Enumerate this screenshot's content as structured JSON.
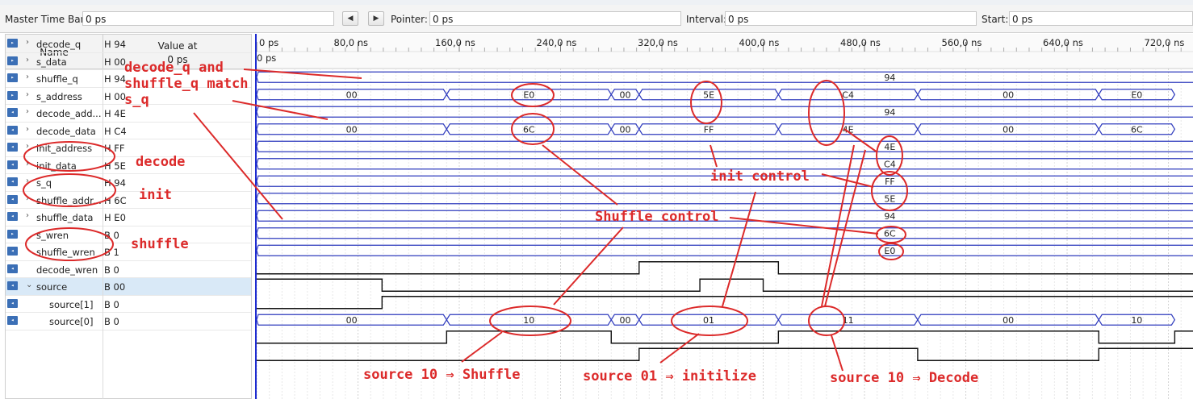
{
  "toolbar": {
    "master_time_bar_label": "Master Time Bar:",
    "master_time_bar_value": "0 ps",
    "prev_btn": "◀",
    "next_btn": "▶",
    "pointer_label": "Pointer:",
    "pointer_value": "0 ps",
    "interval_label": "Interval:",
    "interval_value": "0 ps",
    "start_label": "Start:",
    "start_value": "0 ps"
  },
  "header": {
    "name": "Name",
    "value_at": "Value at",
    "value_at_time": "0 ps"
  },
  "ruler": {
    "labels": [
      "0 ps",
      "80,0 ns",
      "160,0 ns",
      "240,0 ns",
      "320,0 ns",
      "400,0 ns",
      "480,0 ns",
      "560,0 ns",
      "640,0 ns",
      "720,0 ns"
    ],
    "cursor_label": "0 ps"
  },
  "signals": [
    {
      "name": "decode_q",
      "value": "H 94",
      "type": "out",
      "expand": "›"
    },
    {
      "name": "s_data",
      "value": "H 00",
      "type": "out",
      "expand": "›"
    },
    {
      "name": "shuffle_q",
      "value": "H 94",
      "type": "out",
      "expand": "›"
    },
    {
      "name": "s_address",
      "value": "H 00",
      "type": "out",
      "expand": "›"
    },
    {
      "name": "decode_add...",
      "value": "H 4E",
      "type": "in",
      "expand": "›"
    },
    {
      "name": "decode_data",
      "value": "H C4",
      "type": "in",
      "expand": "›"
    },
    {
      "name": "init_address",
      "value": "H FF",
      "type": "in",
      "expand": "›"
    },
    {
      "name": "init_data",
      "value": "H 5E",
      "type": "in",
      "expand": "›"
    },
    {
      "name": "s_q",
      "value": "H 94",
      "type": "in",
      "expand": "›"
    },
    {
      "name": "shuffle_addr...",
      "value": "H 6C",
      "type": "in",
      "expand": "›"
    },
    {
      "name": "shuffle_data",
      "value": "H E0",
      "type": "in",
      "expand": "›"
    },
    {
      "name": "s_wren",
      "value": "B 0",
      "type": "out",
      "expand": ""
    },
    {
      "name": "shuffle_wren",
      "value": "B 1",
      "type": "in",
      "expand": ""
    },
    {
      "name": "decode_wren",
      "value": "B 0",
      "type": "in",
      "expand": ""
    },
    {
      "name": "source",
      "value": "B 00",
      "type": "in",
      "expand": "⌄"
    },
    {
      "name": "source[1]",
      "value": "B 0",
      "type": "in",
      "expand": ""
    },
    {
      "name": "source[0]",
      "value": "B 0",
      "type": "in",
      "expand": ""
    }
  ],
  "waves": {
    "decode_q": "94",
    "s_data": [
      "00",
      "E0",
      "00",
      "5E",
      "C4",
      "00",
      "E0"
    ],
    "shuffle_q": "94",
    "s_address": [
      "00",
      "6C",
      "00",
      "FF",
      "4E",
      "00",
      "6C"
    ],
    "decode_address": "4E",
    "decode_data": "C4",
    "init_address": "FF",
    "init_data": "5E",
    "s_q": "94",
    "shuffle_address": "6C",
    "shuffle_data": "E0",
    "source": [
      "00",
      "10",
      "00",
      "01",
      "11",
      "00",
      "10"
    ]
  },
  "annotations": {
    "match": "decode_q and\nshuffle_q match\ns_q",
    "decode": "decode",
    "init": "init",
    "shuffle": "shuffle",
    "init_control": "init control",
    "shuffle_control": "Shuffle control",
    "source_shuffle": "source 10 ⇒ Shuffle",
    "source_init": "source 01 ⇒ initilize",
    "source_decode": "source 10 ⇒ Decode"
  },
  "icons": {
    "out": "out-port-icon",
    "in": "in-port-icon"
  },
  "colors": {
    "wave_blue": "#2f3bbd",
    "wave_black": "#111111",
    "annotation_red": "#dc2a2a",
    "cursor_blue": "#1d2bd0"
  }
}
